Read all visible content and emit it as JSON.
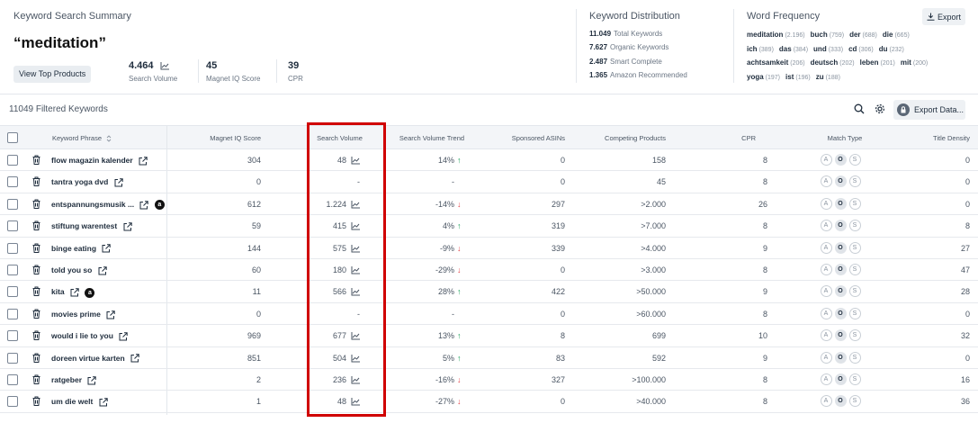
{
  "summary": {
    "title": "Keyword Search Summary",
    "keyword": "“meditation”",
    "view_top_products_label": "View Top Products",
    "search_volume": {
      "value": "4.464",
      "label": "Search Volume"
    },
    "magnet_iq": {
      "value": "45",
      "label": "Magnet IQ Score"
    },
    "cpr": {
      "value": "39",
      "label": "CPR"
    }
  },
  "distribution": {
    "title": "Keyword Distribution",
    "rows": [
      {
        "value": "11.049",
        "label": "Total Keywords"
      },
      {
        "value": "7.627",
        "label": "Organic Keywords"
      },
      {
        "value": "2.487",
        "label": "Smart Complete"
      },
      {
        "value": "1.365",
        "label": "Amazon Recommended"
      }
    ]
  },
  "word_frequency": {
    "title": "Word Frequency",
    "export_label": "Export",
    "lines": [
      [
        {
          "word": "meditation",
          "count": "(2.196)"
        },
        {
          "word": "buch",
          "count": "(759)"
        },
        {
          "word": "der",
          "count": "(688)"
        },
        {
          "word": "die",
          "count": "(665)"
        }
      ],
      [
        {
          "word": "ich",
          "count": "(389)"
        },
        {
          "word": "das",
          "count": "(384)"
        },
        {
          "word": "und",
          "count": "(333)"
        },
        {
          "word": "cd",
          "count": "(306)"
        },
        {
          "word": "du",
          "count": "(232)"
        }
      ],
      [
        {
          "word": "achtsamkeit",
          "count": "(206)"
        },
        {
          "word": "deutsch",
          "count": "(202)"
        },
        {
          "word": "leben",
          "count": "(201)"
        },
        {
          "word": "mit",
          "count": "(200)"
        }
      ],
      [
        {
          "word": "yoga",
          "count": "(197)"
        },
        {
          "word": "ist",
          "count": "(196)"
        },
        {
          "word": "zu",
          "count": "(188)"
        }
      ]
    ]
  },
  "toolbar": {
    "filtered_label": "11049 Filtered Keywords",
    "export_data_label": "Export Data..."
  },
  "table": {
    "headers": {
      "keyword": "Keyword Phrase",
      "magnet_iq": "Magnet IQ Score",
      "search_volume": "Search Volume",
      "trend": "Search Volume Trend",
      "sponsored": "Sponsored ASINs",
      "competing": "Competing Products",
      "cpr": "CPR",
      "match_type": "Match Type",
      "title_density": "Title Density"
    },
    "match_labels": [
      "A",
      "O",
      "S"
    ],
    "rows": [
      {
        "keyword": "flow magazin kalender",
        "amazon": false,
        "iq": "304",
        "sv": "48",
        "sv_chart": true,
        "trend": "14%",
        "dir": "up",
        "sponsored": "0",
        "competing": "158",
        "cpr": "8",
        "density": "0"
      },
      {
        "keyword": "tantra yoga dvd",
        "amazon": false,
        "iq": "0",
        "sv": "-",
        "sv_chart": false,
        "trend": "-",
        "dir": "none",
        "sponsored": "0",
        "competing": "45",
        "cpr": "8",
        "density": "0"
      },
      {
        "keyword": "entspannungsmusik ...",
        "amazon": true,
        "iq": "612",
        "sv": "1.224",
        "sv_chart": true,
        "trend": "-14%",
        "dir": "down",
        "sponsored": "297",
        "competing": ">2.000",
        "cpr": "26",
        "density": "0"
      },
      {
        "keyword": "stiftung warentest",
        "amazon": false,
        "iq": "59",
        "sv": "415",
        "sv_chart": true,
        "trend": "4%",
        "dir": "up",
        "sponsored": "319",
        "competing": ">7.000",
        "cpr": "8",
        "density": "8"
      },
      {
        "keyword": "binge eating",
        "amazon": false,
        "iq": "144",
        "sv": "575",
        "sv_chart": true,
        "trend": "-9%",
        "dir": "down",
        "sponsored": "339",
        "competing": ">4.000",
        "cpr": "9",
        "density": "27"
      },
      {
        "keyword": "told you so",
        "amazon": false,
        "iq": "60",
        "sv": "180",
        "sv_chart": true,
        "trend": "-29%",
        "dir": "down",
        "sponsored": "0",
        "competing": ">3.000",
        "cpr": "8",
        "density": "47"
      },
      {
        "keyword": "kita",
        "amazon": true,
        "iq": "11",
        "sv": "566",
        "sv_chart": true,
        "trend": "28%",
        "dir": "up",
        "sponsored": "422",
        "competing": ">50.000",
        "cpr": "9",
        "density": "28"
      },
      {
        "keyword": "movies prime",
        "amazon": false,
        "iq": "0",
        "sv": "-",
        "sv_chart": false,
        "trend": "-",
        "dir": "none",
        "sponsored": "0",
        "competing": ">60.000",
        "cpr": "8",
        "density": "0"
      },
      {
        "keyword": "would i lie to you",
        "amazon": false,
        "iq": "969",
        "sv": "677",
        "sv_chart": true,
        "trend": "13%",
        "dir": "up",
        "sponsored": "8",
        "competing": "699",
        "cpr": "10",
        "density": "32"
      },
      {
        "keyword": "doreen virtue karten",
        "amazon": false,
        "iq": "851",
        "sv": "504",
        "sv_chart": true,
        "trend": "5%",
        "dir": "up",
        "sponsored": "83",
        "competing": "592",
        "cpr": "9",
        "density": "0"
      },
      {
        "keyword": "ratgeber",
        "amazon": false,
        "iq": "2",
        "sv": "236",
        "sv_chart": true,
        "trend": "-16%",
        "dir": "down",
        "sponsored": "327",
        "competing": ">100.000",
        "cpr": "8",
        "density": "16"
      },
      {
        "keyword": "um die welt",
        "amazon": false,
        "iq": "1",
        "sv": "48",
        "sv_chart": true,
        "trend": "-27%",
        "dir": "down",
        "sponsored": "0",
        "competing": ">40.000",
        "cpr": "8",
        "density": "36"
      }
    ]
  },
  "colors": {
    "highlight": "#d00000",
    "up": "#18a058",
    "down": "#e5484d"
  }
}
